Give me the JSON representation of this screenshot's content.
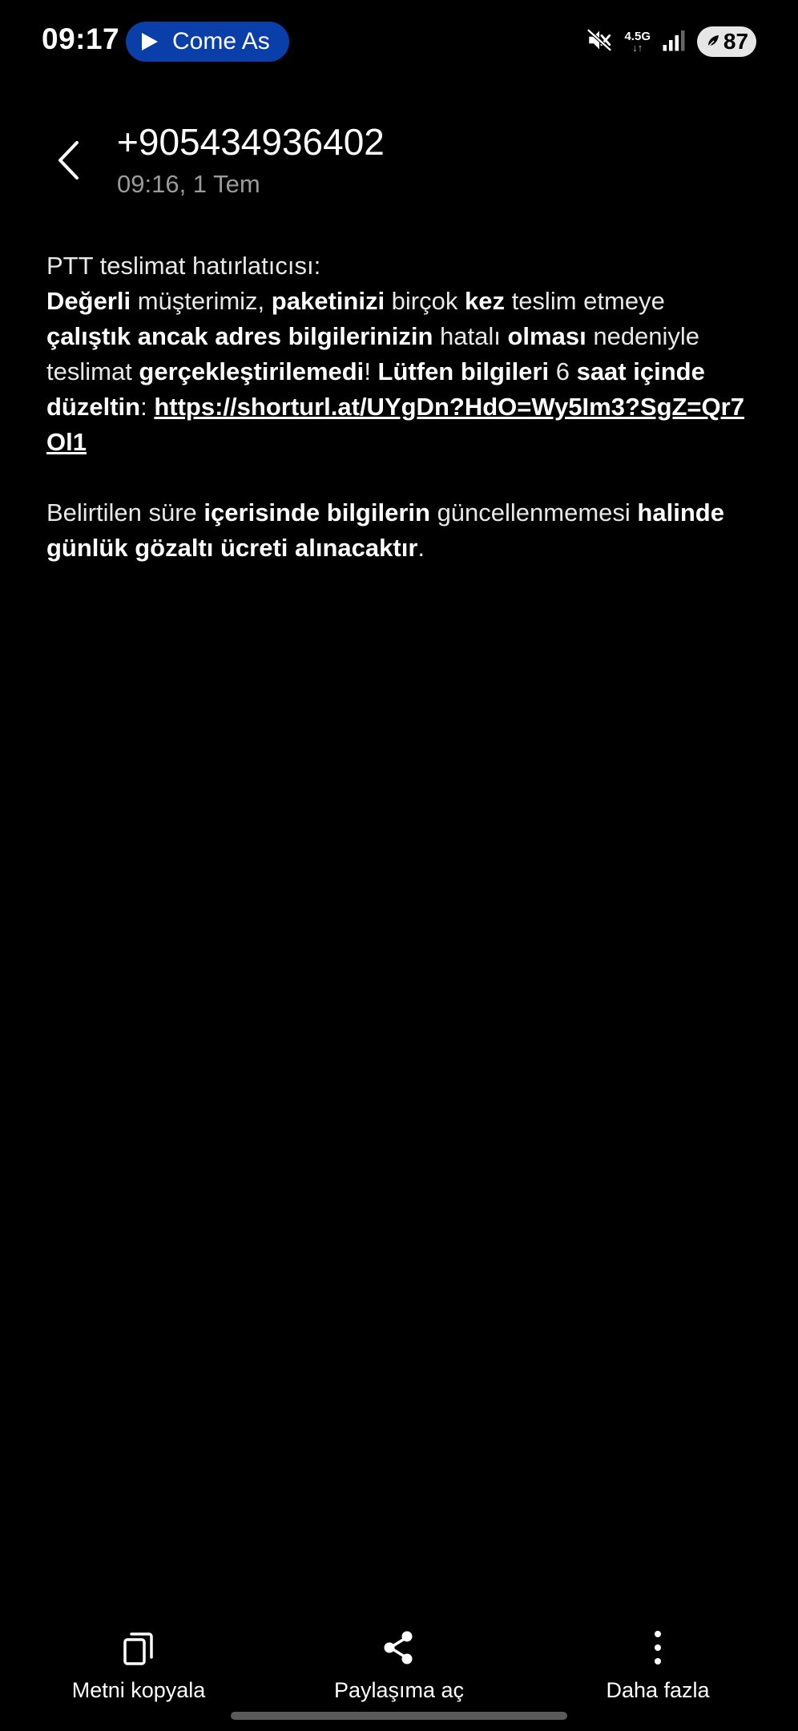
{
  "status_bar": {
    "time": "09:17",
    "media_title": "Come As",
    "network_type": "4.5G",
    "battery_level": "87",
    "icons": [
      "play-icon",
      "mute-icon",
      "data-arrows-icon",
      "signal-icon",
      "battery-saver-icon"
    ]
  },
  "header": {
    "sender": "+905434936402",
    "timestamp": "09:16, 1 Tem",
    "back_icon": "chevron-left-icon"
  },
  "message": {
    "l1": " PTT teslimat hatırlatıcısı:",
    "s1": "Değerli",
    "s2": " müşterimiz, ",
    "s3": "paketinizi",
    "s4": " birçok ",
    "s5": "kez",
    "s6": " teslim etmeye ",
    "s7": "çalıştık ancak adres bilgilerinizin",
    "s8": " hatalı ",
    "s9": "olması",
    "s10": " nedeniyle teslimat ",
    "s11": "gerçekleştirilemedi",
    "s12": "! ",
    "s13": "Lütfen bilgileri",
    "s14": " 6 ",
    "s15": "saat içinde düzeltin",
    "s16": ": ",
    "link": "https://shorturl.at/UYgDn?HdO=Wy5Im3?SgZ=Qr7Ol1",
    "t1": "Belirtilen süre ",
    "t2": "içerisinde bilgilerin",
    "t3": " güncellenmemesi ",
    "t4": "halinde günlük gözaltı ücreti alınacaktır",
    "t5": "."
  },
  "toolbar": {
    "copy_label": "Metni kopyala",
    "share_label": "Paylaşıma aç",
    "more_label": "Daha fazla",
    "icons": [
      "copy-icon",
      "share-icon",
      "more-vertical-icon"
    ]
  },
  "colors": {
    "background": "#000000",
    "text": "#ffffff",
    "timestamp": "#9a9a9a",
    "media_pill": "#0a3ea8"
  }
}
